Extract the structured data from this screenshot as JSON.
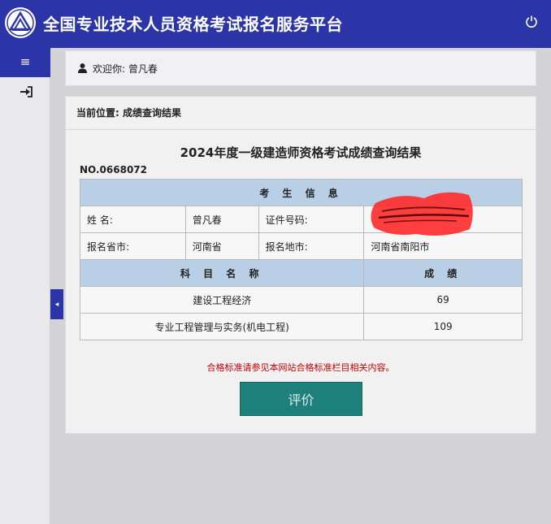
{
  "header": {
    "title": "全国专业技术人员资格考试报名服务平台",
    "logo_icon": "exam-authority-logo-icon",
    "power_icon": "power-icon",
    "color": "#2b35a8"
  },
  "sidebar": {
    "menu_icon": "≡",
    "login_icon": "sign-in-icon",
    "collapse_icon": "◂"
  },
  "welcome": {
    "text": "欢迎你:  曾凡春"
  },
  "breadcrumb": {
    "text": "当前位置:  成绩查询结果"
  },
  "result": {
    "title": "2024年度一级建造师资格考试成绩查询结果",
    "ref_no": "NO.0668072",
    "info_header": "考 生 信 息",
    "name_label": "姓    名:",
    "name_value": "曾凡春",
    "id_label": "证件号码:",
    "id_value": "(已涂抹)",
    "province_label": "报名省市:",
    "province_value": "河南省",
    "city_label": "报名地市:",
    "city_value": "河南省南阳市",
    "subject_header": "科 目 名 称",
    "score_header": "成 绩",
    "subjects": [
      {
        "name": "建设工程经济",
        "score": "69"
      },
      {
        "name": "专业工程管理与实务(机电工程)",
        "score": "109"
      }
    ]
  },
  "note": "合格标准请参见本网站合格标准栏目相关内容。",
  "rate_button": "评价",
  "colors": {
    "table_header": "#b9cfe6",
    "note": "#c00000",
    "button": "#1e807a"
  }
}
